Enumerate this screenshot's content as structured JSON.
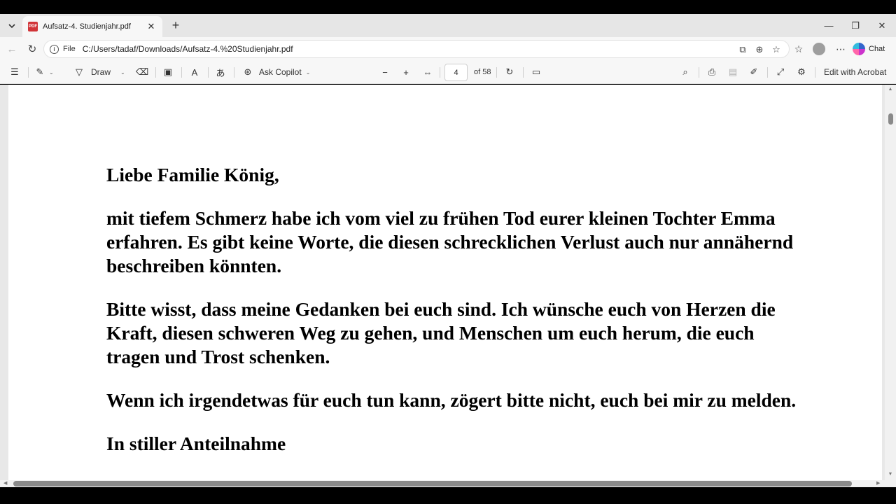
{
  "browser": {
    "tab": {
      "title": "Aufsatz-4. Studienjahr.pdf",
      "icon": "pdf-icon"
    },
    "address": {
      "scheme_label": "File",
      "url": "C:/Users/tadaf/Downloads/Aufsatz-4.%20Studienjahr.pdf"
    },
    "chat_label": "Chat"
  },
  "pdf_toolbar": {
    "draw_label": "Draw",
    "ask_copilot_label": "Ask Copilot",
    "page_number": "4",
    "page_total_label": "of 58",
    "edit_label": "Edit with Acrobat"
  },
  "document": {
    "greeting": "Liebe Familie König,",
    "paragraphs": [
      "mit tiefem Schmerz habe ich vom viel zu frühen Tod eurer kleinen Tochter Emma erfahren. Es gibt keine Worte, die diesen schrecklichen Verlust auch nur annähernd beschreiben könnten.",
      "Bitte wisst, dass meine Gedanken bei euch sind. Ich wünsche euch von Herzen die Kraft, diesen schweren Weg zu gehen, und Menschen um euch herum, die euch tragen und Trost schenken.",
      "Wenn ich irgendetwas für euch tun kann, zögert bitte nicht, euch bei mir zu melden."
    ],
    "closing": "In stiller Anteilnahme"
  }
}
